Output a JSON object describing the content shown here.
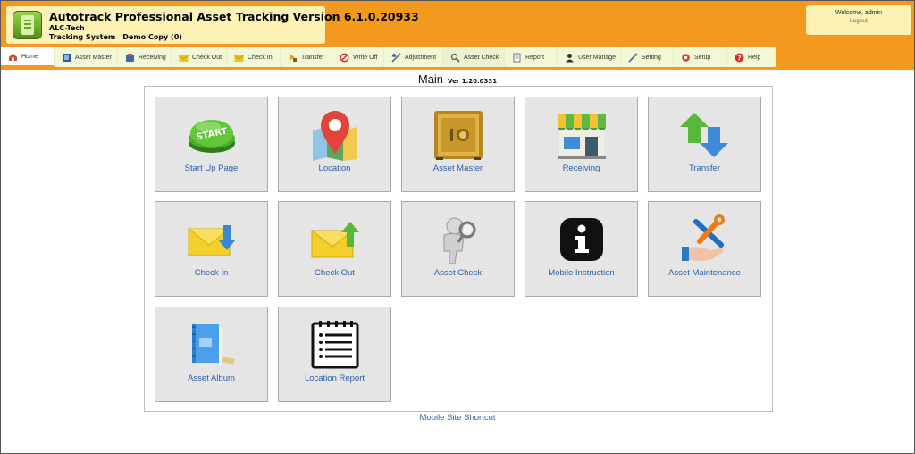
{
  "header": {
    "title": "Autotrack Professional Asset Tracking Version 6.1.0.20933",
    "company": "ALC-Tech",
    "system": "Tracking System",
    "copy": "Demo Copy (0)"
  },
  "user": {
    "welcome": "Welcome, admin",
    "logout": "Logout"
  },
  "nav": [
    {
      "label": "Home",
      "icon": "home-icon"
    },
    {
      "label": "Asset Master",
      "icon": "asset-master-icon"
    },
    {
      "label": "Receiving",
      "icon": "receiving-icon"
    },
    {
      "label": "Check Out",
      "icon": "envelope-out-icon"
    },
    {
      "label": "Check In",
      "icon": "envelope-in-icon"
    },
    {
      "label": "Transfer",
      "icon": "transfer-icon"
    },
    {
      "label": "Write Off",
      "icon": "no-entry-icon"
    },
    {
      "label": "Adjustment",
      "icon": "adjust-icon"
    },
    {
      "label": "Asset Check",
      "icon": "asset-check-icon"
    },
    {
      "label": "Report",
      "icon": "report-icon"
    },
    {
      "label": "User Manage",
      "icon": "user-icon"
    },
    {
      "label": "Setting",
      "icon": "setting-icon"
    },
    {
      "label": "Setup",
      "icon": "setup-icon"
    },
    {
      "label": "Help",
      "icon": "help-icon"
    }
  ],
  "main": {
    "title": "Main",
    "version": "Ver 1.20.0331"
  },
  "tiles": [
    {
      "label": "Start Up Page",
      "icon": "start-button-icon"
    },
    {
      "label": "Location",
      "icon": "location-pin-icon"
    },
    {
      "label": "Asset Master",
      "icon": "safe-icon"
    },
    {
      "label": "Receiving",
      "icon": "shop-icon"
    },
    {
      "label": "Transfer",
      "icon": "transfer-arrows-icon"
    },
    {
      "label": "Check In",
      "icon": "envelope-in-icon"
    },
    {
      "label": "Check Out",
      "icon": "envelope-out-icon"
    },
    {
      "label": "Asset Check",
      "icon": "inspector-icon"
    },
    {
      "label": "Mobile Instruction",
      "icon": "info-icon"
    },
    {
      "label": "Asset Maintenance",
      "icon": "tools-icon"
    },
    {
      "label": "Asset Album",
      "icon": "album-icon"
    },
    {
      "label": "Location Report",
      "icon": "checklist-icon"
    }
  ],
  "footer": {
    "shortcut": "Mobile Site Shortcut"
  },
  "colors": {
    "header_bg": "#f39a1e",
    "title_bg": "#fef3b4",
    "nav_bg": "#f2f7d6",
    "tile_bg": "#e5e5e5",
    "link": "#2c5ea8"
  }
}
